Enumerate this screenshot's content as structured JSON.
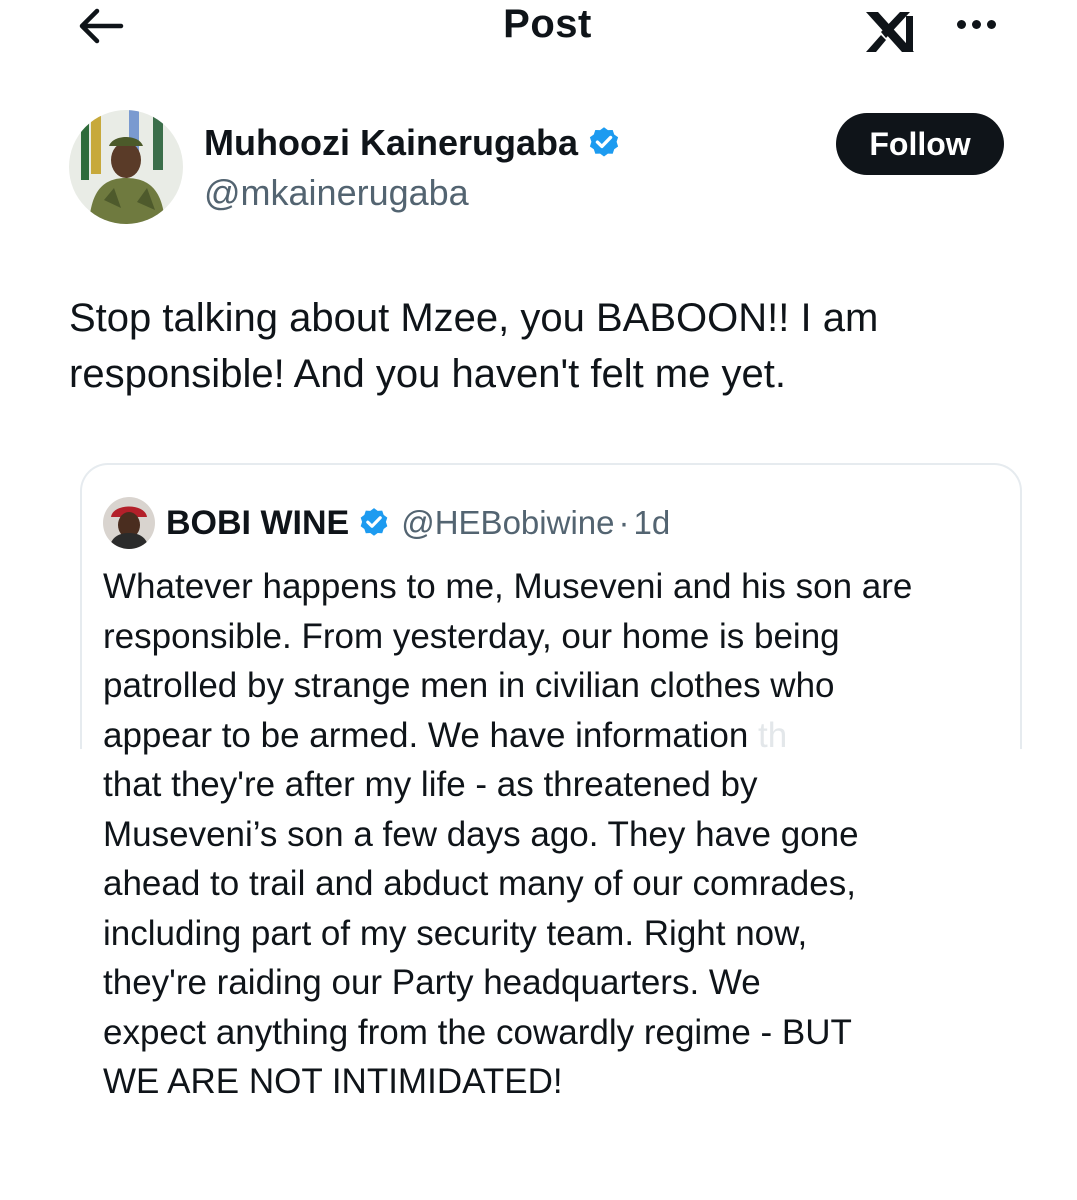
{
  "header": {
    "title": "Post"
  },
  "author": {
    "name": "Muhoozi Kainerugaba",
    "handle": "@mkainerugaba",
    "follow_label": "Follow"
  },
  "post": {
    "text": "Stop talking about Mzee, you BABOON!! I am responsible! And you haven't felt me yet."
  },
  "quoted_post": {
    "name": "BOBI WINE",
    "handle": "@HEBobiwine",
    "separator": "·",
    "time": "1d",
    "lines": [
      "Whatever happens to me, Museveni and his son are",
      "responsible. From yesterday, our home is being",
      "patrolled by strange men in civilian clothes who",
      "appear to be armed. We have information",
      "that they're after my life - as threatened by",
      "Museveni’s son a few days ago. They have gone",
      "ahead to trail and abduct many of our comrades,",
      "including part of my security team. Right now,",
      "they're raiding our Party headquarters. We",
      "expect anything from the cowardly regime - BUT",
      "WE ARE NOT INTIMIDATED!"
    ],
    "faded_fragment": "th"
  },
  "colors": {
    "text": "#0f1419",
    "secondary_text": "#536471",
    "verified": "#1d9bf0",
    "follow_bg": "#0f1419",
    "card_border": "#e6ebef"
  },
  "icons": {
    "back": "arrow-left-icon",
    "logo": "x-logo-icon",
    "more": "more-dots-icon",
    "verified": "verified-badge-icon"
  }
}
